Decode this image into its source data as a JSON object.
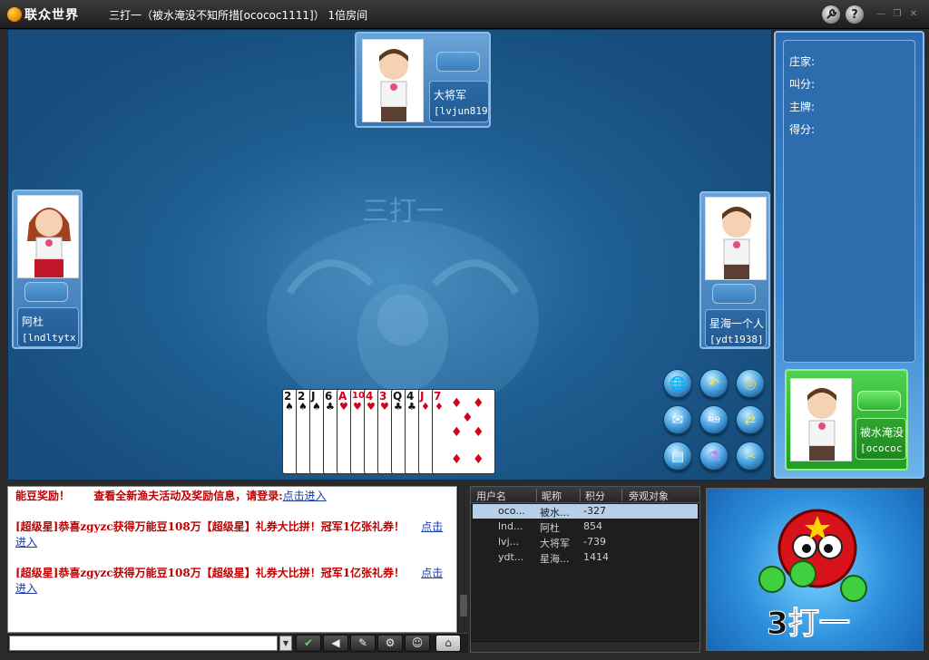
{
  "app": {
    "logo_text": "联众世界",
    "window_title": "三打一（被水淹没不知所措[ocococ1111]） 1倍房间",
    "tools_icon": "wrench-icon",
    "help_icon": "help-icon",
    "help_glyph": "?",
    "minimize_glyph": "—",
    "restore_glyph": "❐",
    "close_glyph": "✕"
  },
  "players": {
    "top": {
      "name": "大将军",
      "id": "[lvjun819"
    },
    "left": {
      "name": "阿杜",
      "id": "[lndltytx"
    },
    "right": {
      "name": "星海一个人",
      "id": "[ydt1938]"
    },
    "self": {
      "name": "被水淹没",
      "id": "[ocococ"
    }
  },
  "hand": [
    {
      "rank": "2",
      "suit": "♠",
      "color": "black"
    },
    {
      "rank": "2",
      "suit": "♠",
      "color": "black"
    },
    {
      "rank": "J",
      "suit": "♠",
      "color": "black"
    },
    {
      "rank": "6",
      "suit": "♣",
      "color": "black"
    },
    {
      "rank": "A",
      "suit": "♥",
      "color": "red"
    },
    {
      "rank": "10",
      "suit": "♥",
      "color": "red"
    },
    {
      "rank": "4",
      "suit": "♥",
      "color": "red"
    },
    {
      "rank": "3",
      "suit": "♥",
      "color": "red"
    },
    {
      "rank": "Q",
      "suit": "♣",
      "color": "black"
    },
    {
      "rank": "4",
      "suit": "♣",
      "color": "black"
    },
    {
      "rank": "J",
      "suit": "♦",
      "color": "red"
    },
    {
      "rank": "7",
      "suit": "♦",
      "color": "red"
    }
  ],
  "actions": {
    "call_label": "叫分"
  },
  "info": {
    "dealer_label": "庄家:",
    "bid_label": "叫分:",
    "trump_label": "主牌:",
    "score_label": "得分:"
  },
  "chat": {
    "line1": "能豆奖励！",
    "line1b": "查看全新渔夫活动及奖励信息，请登录:",
    "link": "点击进入",
    "line2": "[超级星]恭喜zgyzc获得万能豆108万【超级星】礼券大比拼！冠军1亿张礼券！",
    "line3": "[超级星]恭喜zgyzc获得万能豆108万【超级星】礼券大比拼！冠军1亿张礼券！"
  },
  "user_table": {
    "headers": [
      "用户名",
      "昵称",
      "积分",
      "旁观对象"
    ],
    "rows": [
      {
        "user": "oco...",
        "nick": "被水...",
        "score": "-327"
      },
      {
        "user": "lnd...",
        "nick": "阿杜",
        "score": "854"
      },
      {
        "user": "lvj...",
        "nick": "大将军",
        "score": "-739"
      },
      {
        "user": "ydt...",
        "nick": "星海...",
        "score": "1414"
      }
    ]
  },
  "promo": {
    "title": "3打一"
  },
  "watermark": {
    "title": "三打一"
  },
  "colors": {
    "table_blue": "#1f5f92",
    "self_panel_green": "#1f9e1f",
    "chat_red": "#c00000",
    "link_blue": "#1a3aa8"
  }
}
